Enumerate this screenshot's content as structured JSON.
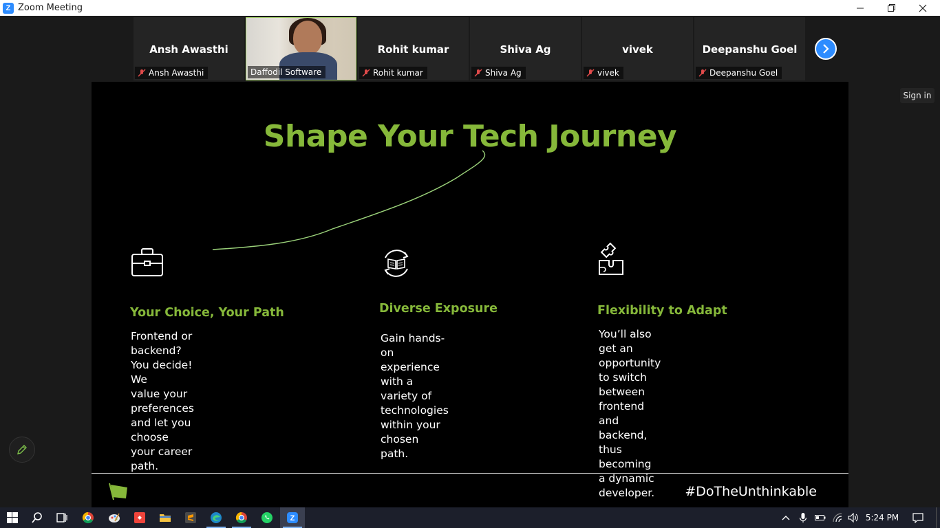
{
  "window": {
    "title": "Zoom Meeting",
    "logo_letter": "Z"
  },
  "participants": [
    {
      "name": "Ansh Awasthi",
      "label": "Ansh Awasthi",
      "muted": true,
      "video": false
    },
    {
      "name": "",
      "label": "Daffodil Software",
      "muted": false,
      "video": true,
      "active": true
    },
    {
      "name": "Rohit kumar",
      "label": "Rohit kumar",
      "muted": true,
      "video": false
    },
    {
      "name": "Shiva Ag",
      "label": "Shiva Ag",
      "muted": true,
      "video": false
    },
    {
      "name": "vivek",
      "label": "vivek",
      "muted": true,
      "video": false
    },
    {
      "name": "Deepanshu Goel",
      "label": "Deepanshu Goel",
      "muted": true,
      "video": false
    }
  ],
  "sign_in": "Sign in",
  "slide": {
    "title": "Shape Your Tech Journey",
    "columns": [
      {
        "icon": "briefcase-icon",
        "heading": "Your Choice, Your Path",
        "lines": [
          "Frontend or backend? You decide! We",
          "value your preferences and let you",
          "choose your career path."
        ]
      },
      {
        "icon": "book-cycle-icon",
        "heading": "Diverse Exposure",
        "lines": [
          "Gain hands-on experience with a",
          "variety of technologies within your",
          "chosen path."
        ]
      },
      {
        "icon": "puzzle-icon",
        "heading": "Flexibility to Adapt",
        "lines": [
          "You’ll also get an opportunity to switch",
          "between frontend and backend, thus",
          "becoming a dynamic developer."
        ]
      }
    ],
    "hashtag": "#DoTheUnthinkable",
    "accent_color": "#86b83a"
  },
  "taskbar": {
    "time": "5:24 PM",
    "apps": [
      "windows-start",
      "search",
      "task-view",
      "chrome",
      "paint",
      "anydesk",
      "file-explorer",
      "sublime-text",
      "edge",
      "chrome",
      "whatsapp",
      "zoom"
    ]
  }
}
